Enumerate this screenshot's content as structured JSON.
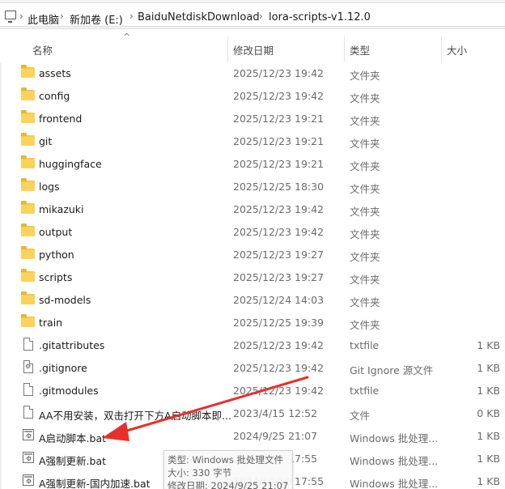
{
  "address": {
    "breadcrumbs": [
      "此电脑",
      "新加卷 (E:)",
      "BaiduNetdiskDownload",
      "lora-scripts-v1.12.0"
    ],
    "separator": "›"
  },
  "columns": {
    "name": "名称",
    "modified": "修改日期",
    "type": "类型",
    "size": "大小",
    "sort_indicator": "^"
  },
  "files": [
    {
      "name": "assets",
      "date": "2025/12/23 19:42",
      "type": "文件夹",
      "size": "",
      "icon": "folder-icon"
    },
    {
      "name": "config",
      "date": "2025/12/23 19:42",
      "type": "文件夹",
      "size": "",
      "icon": "folder-icon"
    },
    {
      "name": "frontend",
      "date": "2025/12/23 19:21",
      "type": "文件夹",
      "size": "",
      "icon": "folder-icon"
    },
    {
      "name": "git",
      "date": "2025/12/23 19:21",
      "type": "文件夹",
      "size": "",
      "icon": "folder-icon"
    },
    {
      "name": "huggingface",
      "date": "2025/12/23 19:21",
      "type": "文件夹",
      "size": "",
      "icon": "folder-icon"
    },
    {
      "name": "logs",
      "date": "2025/12/25 18:30",
      "type": "文件夹",
      "size": "",
      "icon": "folder-icon"
    },
    {
      "name": "mikazuki",
      "date": "2025/12/23 19:42",
      "type": "文件夹",
      "size": "",
      "icon": "folder-icon"
    },
    {
      "name": "output",
      "date": "2025/12/23 19:42",
      "type": "文件夹",
      "size": "",
      "icon": "folder-icon"
    },
    {
      "name": "python",
      "date": "2025/12/23 19:27",
      "type": "文件夹",
      "size": "",
      "icon": "folder-icon"
    },
    {
      "name": "scripts",
      "date": "2025/12/23 19:27",
      "type": "文件夹",
      "size": "",
      "icon": "folder-icon"
    },
    {
      "name": "sd-models",
      "date": "2025/12/24 14:03",
      "type": "文件夹",
      "size": "",
      "icon": "folder-icon"
    },
    {
      "name": "train",
      "date": "2025/12/25 19:39",
      "type": "文件夹",
      "size": "",
      "icon": "folder-icon"
    },
    {
      "name": ".gitattributes",
      "date": "2025/12/23 19:42",
      "type": "txtfile",
      "size": "1 KB",
      "icon": "file-icon"
    },
    {
      "name": ".gitignore",
      "date": "2025/12/23 19:42",
      "type": "Git Ignore 源文件",
      "size": "1 KB",
      "icon": "gitignore-file-icon"
    },
    {
      "name": ".gitmodules",
      "date": "2025/12/23 19:42",
      "type": "txtfile",
      "size": "1 KB",
      "icon": "file-icon"
    },
    {
      "name": "AA不用安装，双击打开下方A启动脚本即...",
      "date": "2023/4/15 12:52",
      "type": "文件",
      "size": "0 KB",
      "icon": "file-icon"
    },
    {
      "name": "A启动脚本.bat",
      "date": "2024/9/25 21:07",
      "type": "Windows 批处理...",
      "size": "1 KB",
      "icon": "batch-file-icon"
    },
    {
      "name": "A强制更新.bat",
      "date": "2024/9/25 17:55",
      "type": "Windows 批处理...",
      "size": "1 KB",
      "icon": "batch-file-icon"
    },
    {
      "name": "A强制更新-国内加速.bat",
      "date": "2024/10/10 17:55",
      "type": "Windows 批处理...",
      "size": "1 KB",
      "icon": "batch-file-icon"
    }
  ],
  "tooltip": {
    "type_line": "类型: Windows 批处理文件",
    "size_line": "大小: 330 字节",
    "modified_line": "修改日期: 2024/9/25 21:07"
  },
  "annotation": {
    "arrow_color": "#e8302a"
  }
}
